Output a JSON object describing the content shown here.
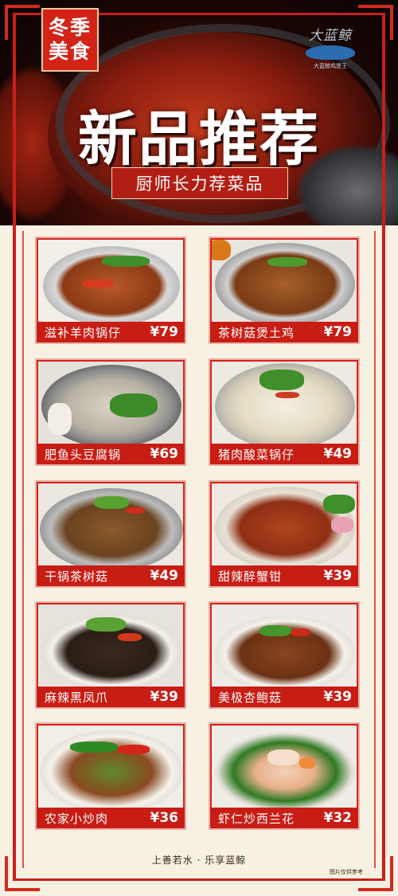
{
  "badge": {
    "line1": "冬季",
    "line2": "美食"
  },
  "logo": {
    "text": "大蓝鲸",
    "sub": "大蓝鲸鸡煲王"
  },
  "headline": "新品推荐",
  "subtitle": "厨师长力荐菜品",
  "dishes": [
    {
      "name": "滋补羊肉锅仔",
      "price": "¥79"
    },
    {
      "name": "茶树菇煲土鸡",
      "price": "¥79"
    },
    {
      "name": "肥鱼头豆腐锅",
      "price": "¥69"
    },
    {
      "name": "猪肉酸菜锅仔",
      "price": "¥49"
    },
    {
      "name": "干锅茶树菇",
      "price": "¥49"
    },
    {
      "name": "甜辣醉蟹钳",
      "price": "¥39"
    },
    {
      "name": "麻辣黑凤爪",
      "price": "¥39"
    },
    {
      "name": "美极杏鲍菇",
      "price": "¥39"
    },
    {
      "name": "农家小炒肉",
      "price": "¥36"
    },
    {
      "name": "虾仁炒西兰花",
      "price": "¥32"
    }
  ],
  "footer": "上善若水 · 乐享蓝鲸",
  "footnote": "图片仅供参考",
  "colors": {
    "accent": "#d6231a",
    "background": "#f7f0e3",
    "hero": "#1a0604"
  }
}
